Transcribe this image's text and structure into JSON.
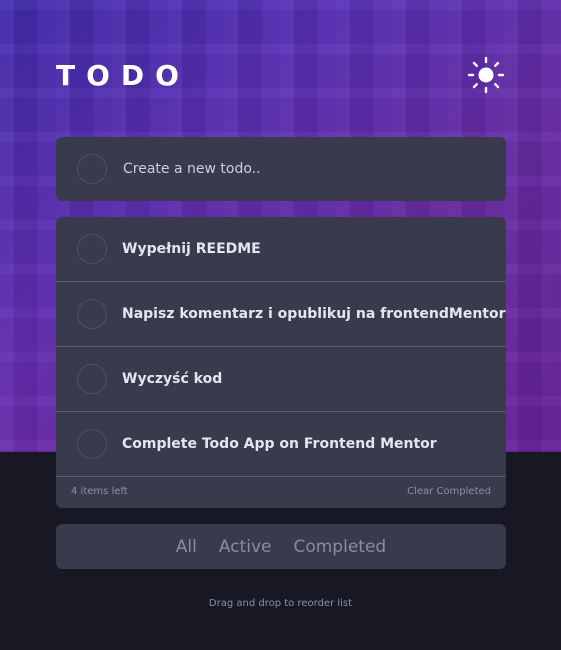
{
  "header": {
    "title": "TODO",
    "theme_icon": "sun-icon"
  },
  "new_todo": {
    "placeholder": "Create a new todo.."
  },
  "todos": [
    {
      "text": "Wypełnij REEDME",
      "completed": false
    },
    {
      "text": "Napisz komentarz i opublikuj na frontendMentor",
      "completed": false
    },
    {
      "text": "Wyczyść kod",
      "completed": false
    },
    {
      "text": "Complete Todo App on Frontend Mentor",
      "completed": false
    }
  ],
  "footer": {
    "items_left": "4 items left",
    "clear_label": "Clear Completed"
  },
  "filters": {
    "all": "All",
    "active": "Active",
    "completed": "Completed"
  },
  "hint": "Drag and drop to reorder list",
  "colors": {
    "page_bg": "#181824",
    "card_bg": "#393a4c",
    "text": "#e4e5f1",
    "muted": "#8c8fa8",
    "hero_from": "#3c2aa8",
    "hero_to": "#6b2a9e"
  }
}
